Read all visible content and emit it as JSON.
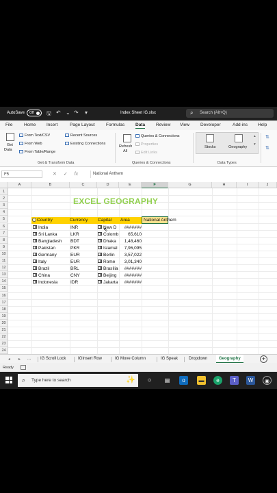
{
  "titlebar": {
    "autosave_label": "AutoSave",
    "autosave_state": "Off",
    "filename": "Index Sheet IG.xlsx",
    "search_placeholder": "Search (Alt+Q)"
  },
  "menu": [
    "File",
    "Home",
    "Insert",
    "Page Layout",
    "Formulas",
    "Data",
    "Review",
    "View",
    "Developer",
    "Add-ins",
    "Help"
  ],
  "menu_active": "Data",
  "ribbon": {
    "get_data": [
      "Get",
      "Data"
    ],
    "from_text_csv": "From Text/CSV",
    "from_web": "From Web",
    "from_table_range": "From Table/Range",
    "recent_sources": "Recent Sources",
    "existing_connections": "Existing Connections",
    "group_get_transform": "Get & Transform Data",
    "refresh": [
      "Refresh",
      "All"
    ],
    "queries_connections": "Queries & Connections",
    "properties": "Properties",
    "edit_links": "Edit Links",
    "group_queries": "Queries & Connections",
    "stocks": "Stocks",
    "geography": "Geography",
    "group_data_types": "Data Types"
  },
  "formula_bar": {
    "cell_ref": "F5",
    "formula": "National Anthem"
  },
  "columns": [
    "A",
    "B",
    "C",
    "D",
    "E",
    "F",
    "G",
    "H",
    "I",
    "J"
  ],
  "selected_column": "F",
  "rows": [
    "1",
    "2",
    "3",
    "4",
    "5",
    "6",
    "7",
    "8",
    "9",
    "10",
    "11",
    "12",
    "13",
    "14",
    "15",
    "16",
    "17",
    "18",
    "19",
    "20",
    "21",
    "22",
    "23",
    "24"
  ],
  "sheet": {
    "title": "EXCEL GEOGRAPHY",
    "headers": {
      "country": "Country",
      "currency": "Currency",
      "capital": "Capital",
      "area": "Area",
      "anthem": "National Anthem"
    },
    "data": [
      {
        "country": "India",
        "currency": "INR",
        "capital": "New D",
        "area": "#######"
      },
      {
        "country": "Sri Lanka",
        "currency": "LKR",
        "capital": "Colomb",
        "area": "65,610"
      },
      {
        "country": "Bangladesh",
        "currency": "BDT",
        "capital": "Dhaka",
        "area": "1,48,460"
      },
      {
        "country": "Pakistan",
        "currency": "PKR",
        "capital": "Islamal",
        "area": "7,96,095"
      },
      {
        "country": "Germany",
        "currency": "EUR",
        "capital": "Berlin",
        "area": "3,57,022"
      },
      {
        "country": "Italy",
        "currency": "EUR",
        "capital": "Rome",
        "area": "3,01,340"
      },
      {
        "country": "Brazil",
        "currency": "BRL",
        "capital": "Brasília",
        "area": "#######"
      },
      {
        "country": "China",
        "currency": "CNY",
        "capital": "Beijing",
        "area": "#######"
      },
      {
        "country": "Indonesia",
        "currency": "IDR",
        "capital": "Jakarta",
        "area": "#######"
      }
    ]
  },
  "sheet_tabs": [
    "IG Scroll Lock",
    "IGInsert Row",
    "IG Move Column",
    "IG Speak",
    "Dropdown",
    "Geography"
  ],
  "sheet_tabs_ellipsis": "...",
  "active_sheet": "Geography",
  "status": "Ready",
  "taskbar": {
    "search_placeholder": "Type here to search"
  }
}
